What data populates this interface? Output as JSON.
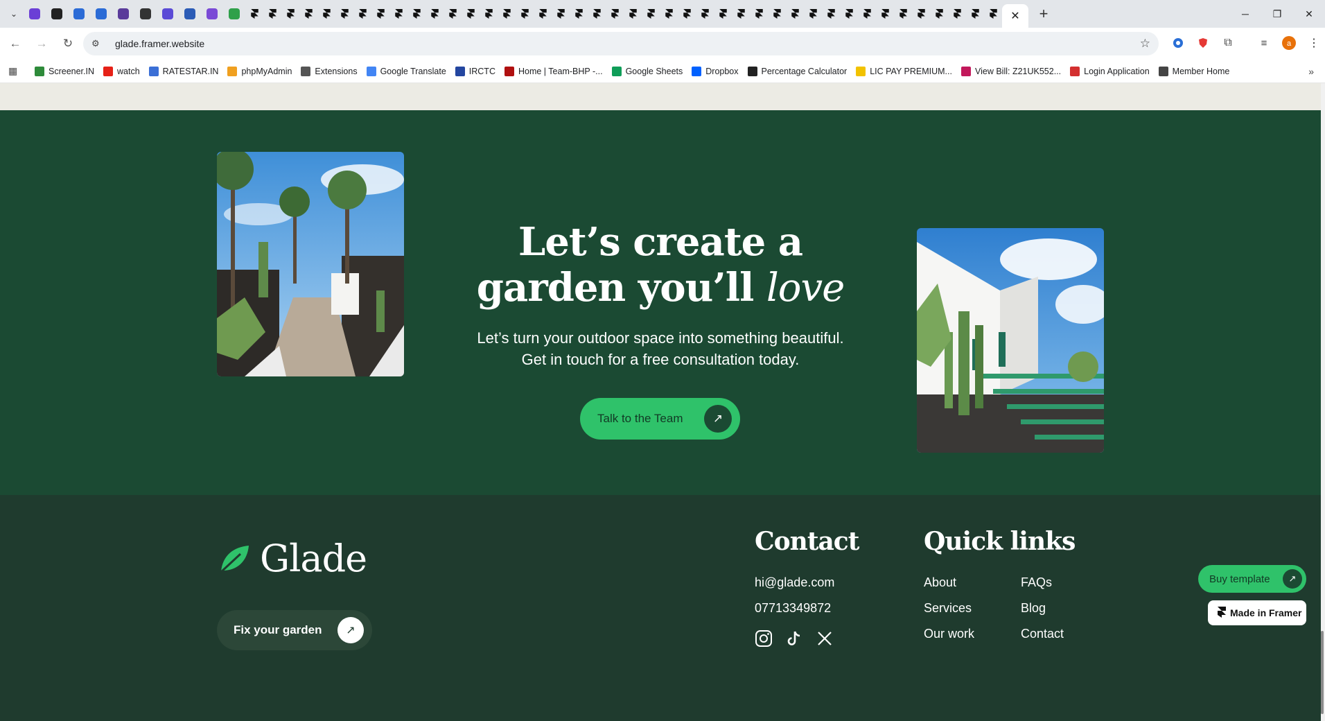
{
  "browser": {
    "url": "glade.framer.website",
    "active_tab_close": "✕",
    "new_tab": "+",
    "window_controls": {
      "minimize": "─",
      "restore": "❐",
      "close": "✕"
    },
    "bookmarks": [
      {
        "label": "Screener.IN",
        "color": "#2e8b3a"
      },
      {
        "label": "watch",
        "color": "#e62117"
      },
      {
        "label": "RATESTAR.IN",
        "color": "#3b6fd6"
      },
      {
        "label": "phpMyAdmin",
        "color": "#f0a020"
      },
      {
        "label": "Extensions",
        "color": "#555555"
      },
      {
        "label": "Google Translate",
        "color": "#4285f4"
      },
      {
        "label": "IRCTC",
        "color": "#2446a0"
      },
      {
        "label": "Home | Team-BHP -...",
        "color": "#b01010"
      },
      {
        "label": "Google Sheets",
        "color": "#0f9d58"
      },
      {
        "label": "Dropbox",
        "color": "#0061fe"
      },
      {
        "label": "Percentage Calculator",
        "color": "#222222"
      },
      {
        "label": "LIC PAY PREMIUM...",
        "color": "#f2c200"
      },
      {
        "label": "View Bill: Z21UK552...",
        "color": "#c2185b"
      },
      {
        "label": "Login Application",
        "color": "#d32f2f"
      },
      {
        "label": "Member Home",
        "color": "#444444"
      }
    ]
  },
  "cta": {
    "headline_line1": "Let’s create a",
    "headline_line2_plain": "garden you’ll ",
    "headline_line2_italic": "love",
    "sub_line1": "Let’s turn your outdoor space into something beautiful.",
    "sub_line2": "Get in touch for a free consultation today.",
    "button_label": "Talk to the Team",
    "button_arrow": "↗"
  },
  "footer": {
    "brand": "Glade",
    "fix_button_label": "Fix your garden",
    "fix_button_arrow": "↗",
    "contact_title": "Contact",
    "email": "hi@glade.com",
    "phone": "07713349872",
    "quick_links_title": "Quick links",
    "links_col1": [
      "About",
      "Services",
      "Our work"
    ],
    "links_col2": [
      "FAQs",
      "Blog",
      "Contact"
    ]
  },
  "floating": {
    "buy_label": "Buy template",
    "buy_arrow": "↗",
    "made_in_framer": "Made in Framer"
  },
  "colors": {
    "cta_bg": "#1b4a33",
    "footer_bg": "#1f3b2e",
    "accent_green": "#2fc26a"
  }
}
